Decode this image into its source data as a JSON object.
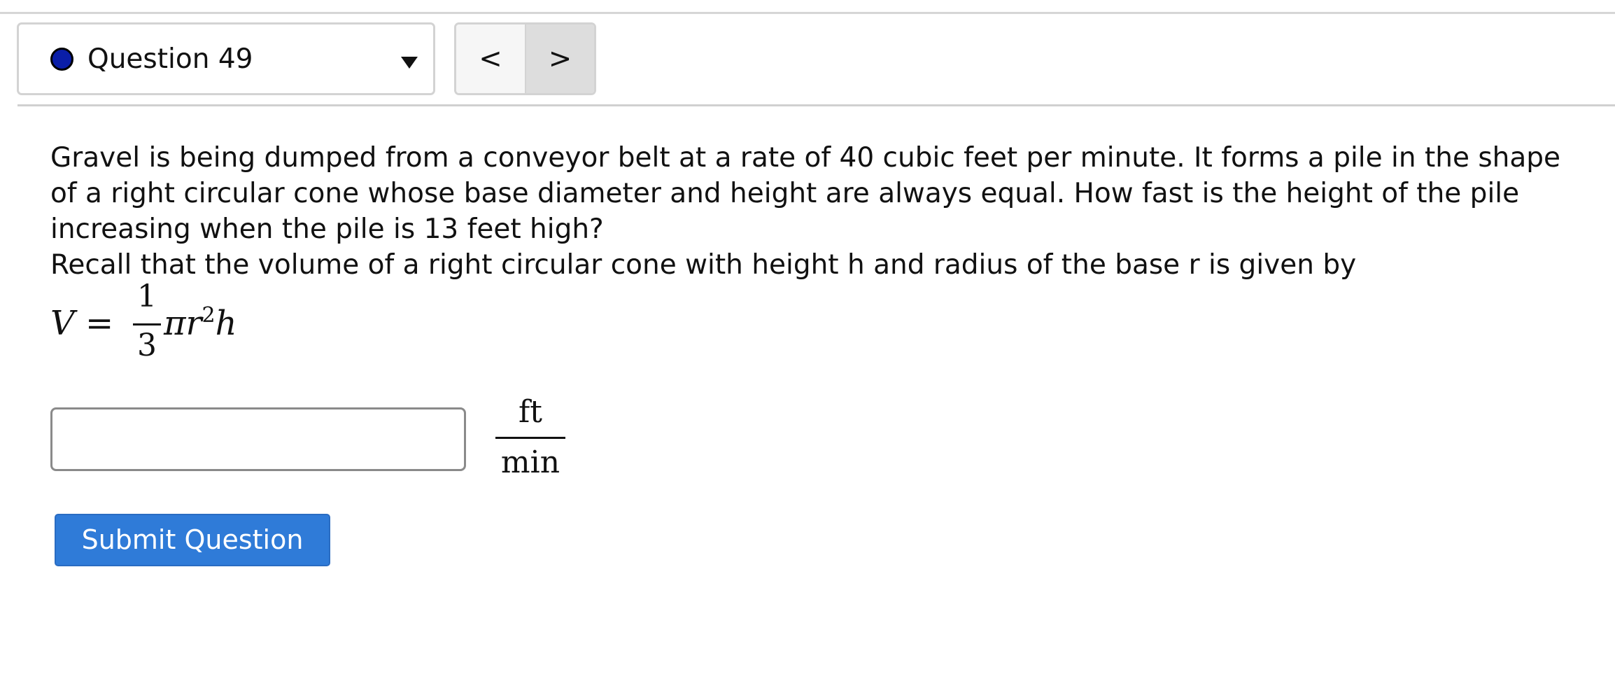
{
  "header": {
    "question_label": "Question 49",
    "status_color": "#0a1ea8",
    "dropdown_icon": "triangle-down",
    "prev_label": "<",
    "next_label": ">"
  },
  "question": {
    "text": "Gravel is being dumped from a conveyor belt at a rate of 40 cubic feet per minute. It forms a pile in the shape of a right circular cone whose base diameter and height are always equal. How fast is the height of the pile increasing when the pile is 13 feet high?",
    "recall": "Recall that the volume of a right circular cone with height h and radius of the base r is given by"
  },
  "formula": {
    "lhs": "V",
    "equals": "=",
    "numerator": "1",
    "denominator": "3",
    "pi_r": "πr",
    "exponent": "2",
    "h": "h"
  },
  "answer": {
    "value": "",
    "placeholder": "",
    "unit_numerator": "ft",
    "unit_denominator": "min"
  },
  "submit": {
    "label": "Submit Question",
    "color": "#2f7bd8"
  }
}
